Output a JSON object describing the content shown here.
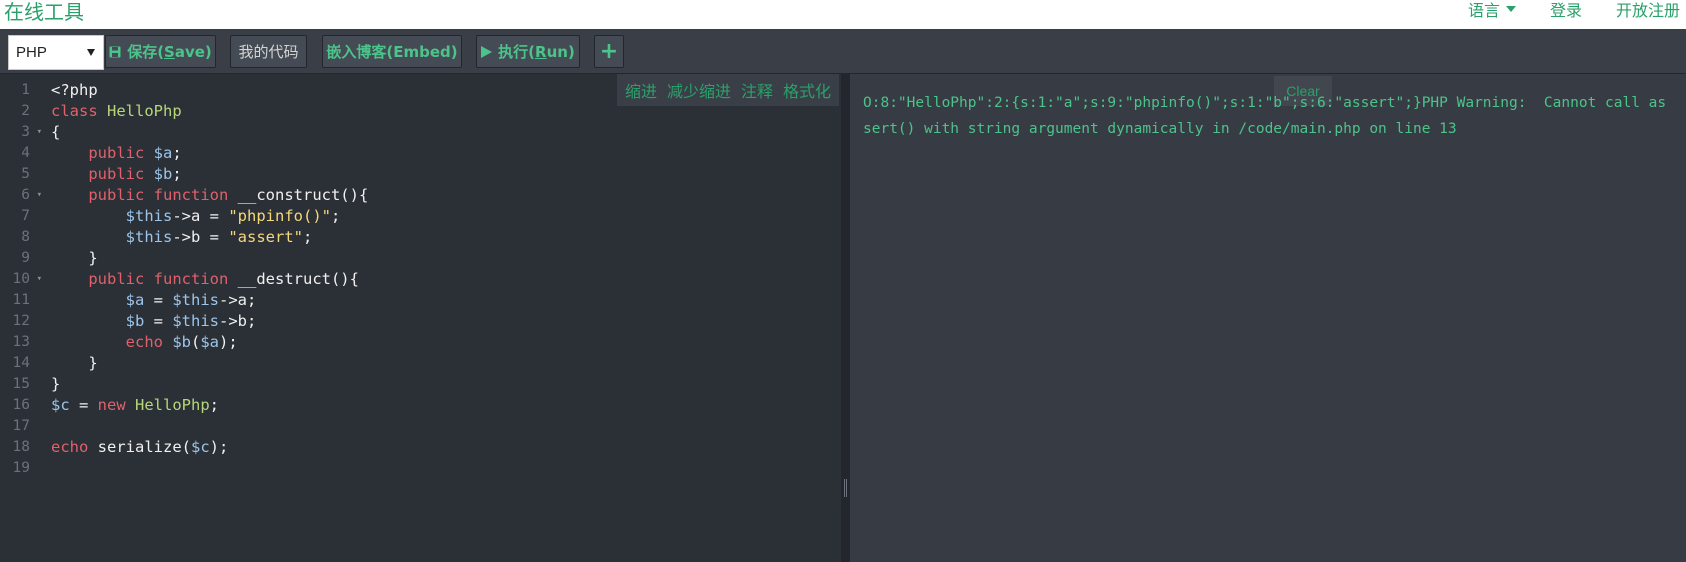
{
  "header": {
    "logo": "在线工具",
    "nav": [
      {
        "label": "语言",
        "has_caret": true
      },
      {
        "label": "登录"
      },
      {
        "label": "开放注册"
      }
    ]
  },
  "toolbar": {
    "language_selected": "PHP",
    "save_prefix": "保存(",
    "save_key": "S",
    "save_suffix": "ave)",
    "my_code": "我的代码",
    "embed": "嵌入博客(Embed)",
    "run_prefix": "执行(",
    "run_key": "R",
    "run_suffix": "un)",
    "add": "+"
  },
  "editor_tools": [
    "缩进",
    "减少缩进",
    "注释",
    "格式化"
  ],
  "editor": {
    "line_numbers": [
      "1",
      "2",
      "3",
      "4",
      "5",
      "6",
      "7",
      "8",
      "9",
      "10",
      "11",
      "12",
      "13",
      "14",
      "15",
      "16",
      "17",
      "18",
      "19"
    ],
    "fold_lines": [
      3,
      6,
      10
    ],
    "code_lines": [
      "<?php",
      "class HelloPhp",
      "{",
      "    public $a;",
      "    public $b;",
      "    public function __construct(){",
      "        $this->a = \"phpinfo()\";",
      "        $this->b = \"assert\";",
      "    }",
      "    public function __destruct(){",
      "        $a = $this->a;",
      "        $b = $this->b;",
      "        echo $b($a);",
      "    }",
      "}",
      "$c = new HelloPhp;",
      "",
      "echo serialize($c);",
      ""
    ]
  },
  "output": {
    "clear_label": "Clear",
    "text": "O:8:\"HelloPhp\":2:{s:1:\"a\";s:9:\"phpinfo()\";s:1:\"b\";s:6:\"assert\";}PHP Warning:  Cannot call assert() with string argument dynamically in /code/main.php on line 13"
  },
  "colors": {
    "accent_green": "#2aa06a",
    "keyword_red": "#e0616b",
    "class_green": "#b8d67a",
    "string_yellow": "#f5d87a",
    "variable_blue": "#9cc5e9",
    "editor_bg": "#2b2f36",
    "output_bg": "#373c44"
  }
}
